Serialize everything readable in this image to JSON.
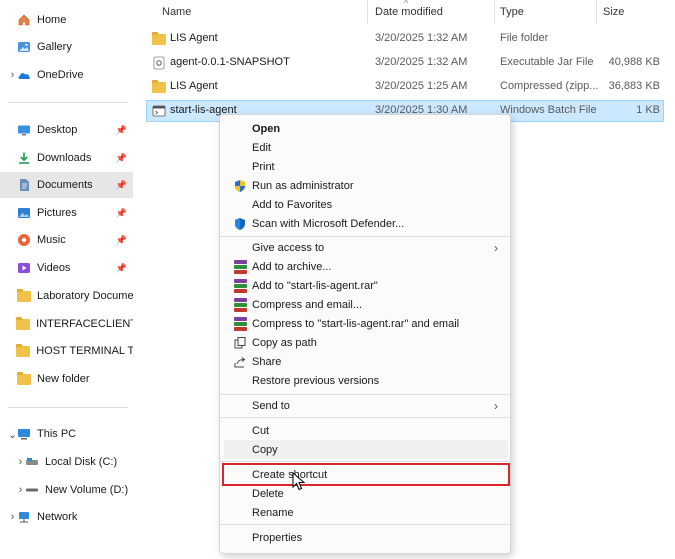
{
  "nav": {
    "items": [
      {
        "label": "Home",
        "icon": "home-icon"
      },
      {
        "label": "Gallery",
        "icon": "gallery-icon"
      },
      {
        "label": "OneDrive",
        "icon": "onedrive-icon"
      },
      {
        "label": "Desktop",
        "icon": "desktop-icon",
        "pinned": true
      },
      {
        "label": "Downloads",
        "icon": "download-icon",
        "pinned": true
      },
      {
        "label": "Documents",
        "icon": "documents-icon",
        "pinned": true,
        "selected": true
      },
      {
        "label": "Pictures",
        "icon": "pictures-icon",
        "pinned": true
      },
      {
        "label": "Music",
        "icon": "music-icon",
        "pinned": true
      },
      {
        "label": "Videos",
        "icon": "videos-icon",
        "pinned": true
      },
      {
        "label": "Laboratory Docume",
        "icon": "folder-icon"
      },
      {
        "label": "INTERFACECLIENT_",
        "icon": "folder-icon"
      },
      {
        "label": "HOST TERMINAL TC",
        "icon": "folder-icon"
      },
      {
        "label": "New folder",
        "icon": "folder-icon"
      },
      {
        "label": "This PC",
        "icon": "this-pc-icon"
      },
      {
        "label": "Local Disk (C:)",
        "icon": "drive-icon"
      },
      {
        "label": "New Volume (D:)",
        "icon": "drive-icon"
      },
      {
        "label": "Network",
        "icon": "network-icon"
      }
    ]
  },
  "columns": {
    "name": "Name",
    "date": "Date modified",
    "type": "Type",
    "size": "Size"
  },
  "files": [
    {
      "name": "LIS Agent",
      "date": "3/20/2025 1:32 AM",
      "type": "File folder",
      "size": "",
      "icon": "folder-icon"
    },
    {
      "name": "agent-0.0.1-SNAPSHOT",
      "date": "3/20/2025 1:32 AM",
      "type": "Executable Jar File",
      "size": "40,988 KB",
      "icon": "jar-icon"
    },
    {
      "name": "LIS Agent",
      "date": "3/20/2025 1:25 AM",
      "type": "Compressed (zipp...",
      "size": "36,883 KB",
      "icon": "zip-folder-icon"
    },
    {
      "name": "start-lis-agent",
      "date": "3/20/2025 1:30 AM",
      "type": "Windows Batch File",
      "size": "1 KB",
      "icon": "batch-file-icon",
      "selected": true
    }
  ],
  "context_menu": {
    "items": [
      {
        "label": "Open",
        "bold": true
      },
      {
        "label": "Edit"
      },
      {
        "label": "Print"
      },
      {
        "label": "Run as administrator",
        "icon": "uac-shield-icon"
      },
      {
        "label": "Add to Favorites"
      },
      {
        "label": "Scan with Microsoft Defender...",
        "icon": "defender-icon"
      },
      {
        "label": "Give access to",
        "submenu": true
      },
      {
        "label": "Add to archive...",
        "icon": "winrar-icon"
      },
      {
        "label": "Add to \"start-lis-agent.rar\"",
        "icon": "winrar-icon"
      },
      {
        "label": "Compress and email...",
        "icon": "winrar-icon"
      },
      {
        "label": "Compress to \"start-lis-agent.rar\" and email",
        "icon": "winrar-icon"
      },
      {
        "label": "Copy as path",
        "icon": "copy-path-icon"
      },
      {
        "label": "Share",
        "icon": "share-icon"
      },
      {
        "label": "Restore previous versions"
      },
      {
        "label": "Send to",
        "submenu": true
      },
      {
        "label": "Cut"
      },
      {
        "label": "Copy",
        "hover": true
      },
      {
        "label": "Create shortcut",
        "highlighted": true
      },
      {
        "label": "Delete"
      },
      {
        "label": "Rename"
      },
      {
        "label": "Properties"
      }
    ]
  },
  "colors": {
    "selection": "#cce8ff",
    "highlight_box": "#d9262a",
    "nav_selected": "#e6e6e6"
  }
}
